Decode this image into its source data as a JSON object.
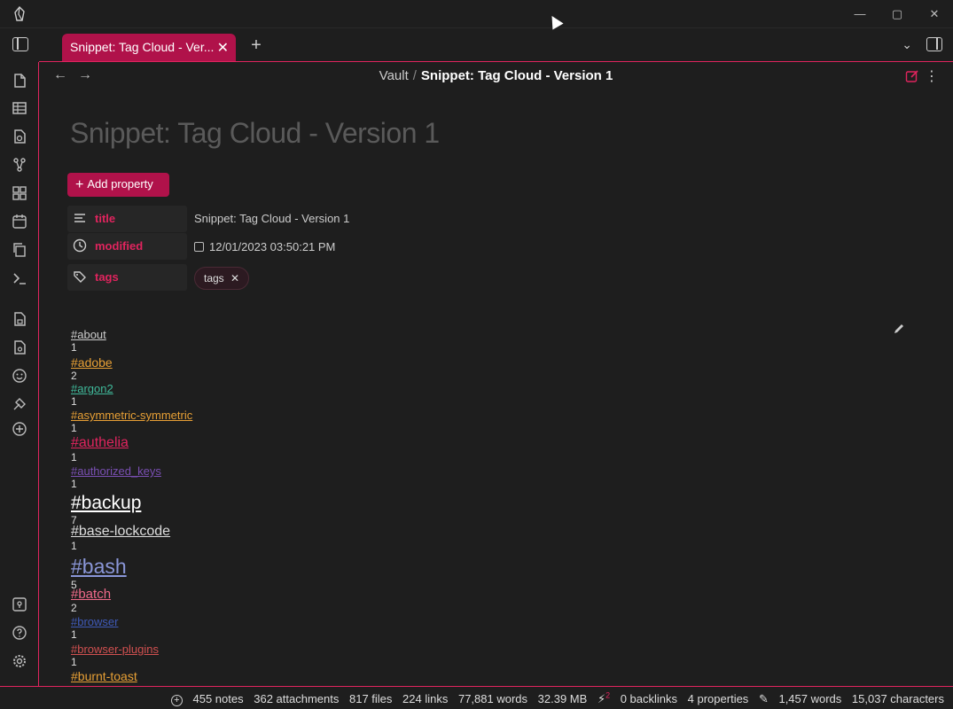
{
  "tab": {
    "label": "Snippet: Tag Cloud - Ver..."
  },
  "breadcrumb": {
    "root": "Vault",
    "sep": "/",
    "current": "Snippet: Tag Cloud - Version 1"
  },
  "note": {
    "title": "Snippet: Tag Cloud - Version 1",
    "add_property_label": "Add property",
    "properties": [
      {
        "key": "title",
        "value": "Snippet: Tag Cloud - Version 1"
      },
      {
        "key": "modified",
        "value": "12/01/2023 03:50:21 PM"
      },
      {
        "key": "tags",
        "value": "tags"
      }
    ]
  },
  "cloud": [
    {
      "tag": "#about",
      "count": "1",
      "color": "#cccccc",
      "size": 13
    },
    {
      "tag": "#adobe",
      "count": "2",
      "color": "#e8a035",
      "size": 14
    },
    {
      "tag": "#argon2",
      "count": "1",
      "color": "#3fb99a",
      "size": 13
    },
    {
      "tag": "#asymmetric-symmetric",
      "count": "1",
      "color": "#e8a035",
      "size": 13
    },
    {
      "tag": "#authelia",
      "count": "1",
      "color": "#e0245e",
      "size": 16
    },
    {
      "tag": "#authorized_keys",
      "count": "1",
      "color": "#7a4fb3",
      "size": 13
    },
    {
      "tag": "#backup",
      "count": "7",
      "color": "#ffffff",
      "size": 21
    },
    {
      "tag": "#base-lockcode",
      "count": "1",
      "color": "#dddddd",
      "size": 16
    },
    {
      "tag": "#bash",
      "count": "5",
      "color": "#8a96d8",
      "size": 23
    },
    {
      "tag": "#batch",
      "count": "2",
      "color": "#f06a8a",
      "size": 15
    },
    {
      "tag": "#browser",
      "count": "1",
      "color": "#3f5ab8",
      "size": 13
    },
    {
      "tag": "#browser-plugins",
      "count": "1",
      "color": "#d05050",
      "size": 13
    },
    {
      "tag": "#burnt-toast",
      "count": "",
      "color": "#e8a035",
      "size": 14
    }
  ],
  "status": {
    "notes": "455 notes",
    "attachments": "362 attachments",
    "files": "817 files",
    "links": "224 links",
    "words_total": "77,881 words",
    "size": "32.39 MB",
    "plugin_badge": "2",
    "backlinks": "0 backlinks",
    "properties": "4 properties",
    "words": "1,457 words",
    "characters": "15,037 characters"
  },
  "colors": {
    "accent": "#e0245e",
    "accent_dark": "#b0124a",
    "background": "#1e1e1e"
  }
}
